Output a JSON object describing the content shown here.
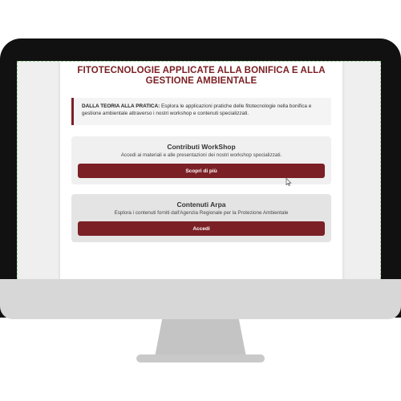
{
  "page": {
    "title": "FITOTECNOLOGIE APPLICATE ALLA BONIFICA E ALLA GESTIONE AMBIENTALE",
    "intro_label": "DALLA TEORIA ALLA PRATICA:",
    "intro_text": "Esplora le applicazioni pratiche delle fitotecnologie nella bonifica e gestione ambientale attraverso i nostri workshop e contenuti specializzati."
  },
  "sections": [
    {
      "title": "Contributi WorkShop",
      "description": "Accedi ai materiali e alle presentazioni dei nostri workshop specializzati.",
      "button": "Scopri di più"
    },
    {
      "title": "Contenuti Arpa",
      "description": "Esplora i contenuti forniti dall'Agenzia Regionale per la Protezione Ambientale",
      "button": "Accedi"
    }
  ],
  "colors": {
    "accent": "#7b2025",
    "monitor_frame": "#111111",
    "monitor_chin": "#d7d7d7"
  },
  "icons": {
    "cursor": "mouse-pointer-icon"
  }
}
